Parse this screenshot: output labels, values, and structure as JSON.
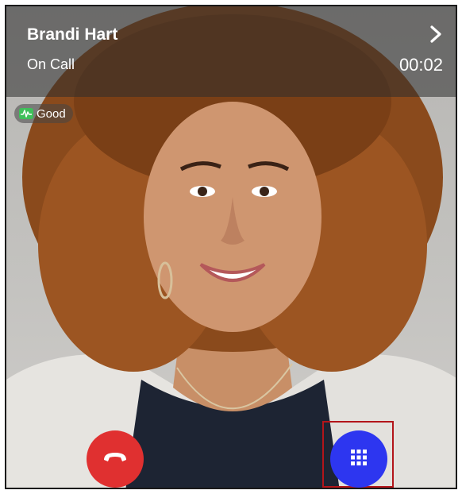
{
  "call": {
    "caller_name": "Brandi Hart",
    "status": "On Call",
    "timer": "00:02",
    "quality_label": "Good"
  },
  "icons": {
    "header_chevron": "chevron-right-icon",
    "quality": "signal-waveform-icon",
    "end_call": "phone-hangup-icon",
    "keypad": "dialpad-icon"
  },
  "colors": {
    "end_call": "#e03030",
    "keypad": "#2d36f0",
    "quality_indicator": "#3fbf5a",
    "highlight_border": "#b3151a"
  }
}
